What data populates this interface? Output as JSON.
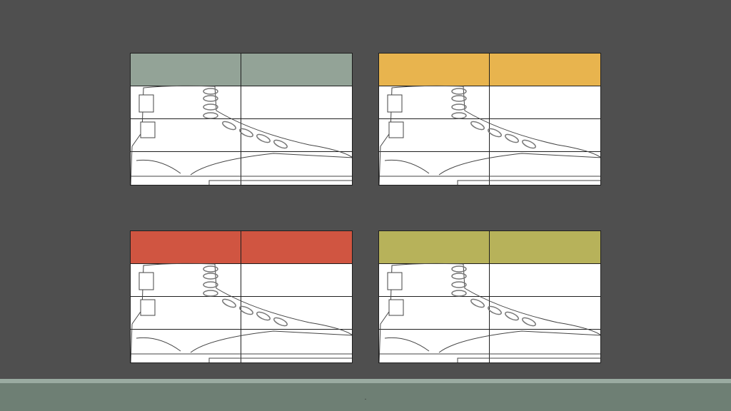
{
  "slide": {
    "background": "#4f4f4f",
    "footer_text": "."
  },
  "cards": [
    {
      "header_color": "#93a397",
      "icon": "boot-outline"
    },
    {
      "header_color": "#e8b44e",
      "icon": "boot-outline"
    },
    {
      "header_color": "#d05541",
      "icon": "boot-outline"
    },
    {
      "header_color": "#b7b25a",
      "icon": "boot-outline"
    }
  ],
  "footer": {
    "color": "#6e7f74",
    "line_color": "#9aaba1"
  }
}
